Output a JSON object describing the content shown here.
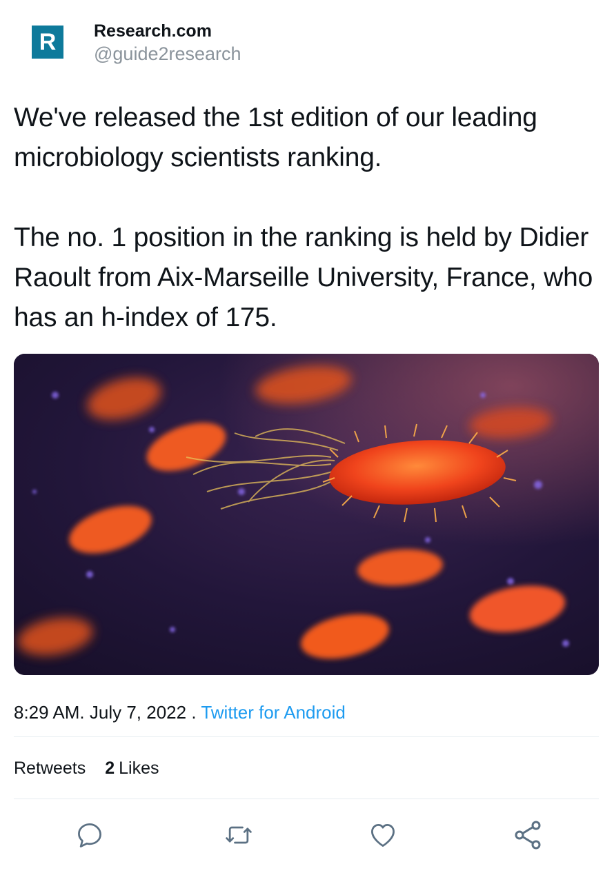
{
  "account": {
    "logo_letter": "R",
    "display_name": "Research.com",
    "handle": "@guide2research"
  },
  "tweet": {
    "text": "We've released the 1st edition of our leading microbiology scientists ranking.\n\nThe no. 1 position in the ranking is held by Didier Raoult from Aix-Marseille University, France, who has an h-index of 175.",
    "media": {
      "description_icon": "bacteria-image"
    },
    "time": "8:29 AM",
    "date": "July 7, 2022",
    "separator_1": ".",
    "separator_2": ".",
    "source": "Twitter for Android"
  },
  "stats": {
    "retweets_label": "Retweets",
    "likes_count": "2",
    "likes_label": "Likes"
  },
  "actions": {
    "reply_icon": "reply-icon",
    "retweet_icon": "retweet-icon",
    "like_icon": "heart-icon",
    "share_icon": "share-icon"
  },
  "colors": {
    "logo": "#0e7a9b",
    "link": "#1d9bf0",
    "muted": "#8a939b",
    "icon": "#5b7083"
  }
}
